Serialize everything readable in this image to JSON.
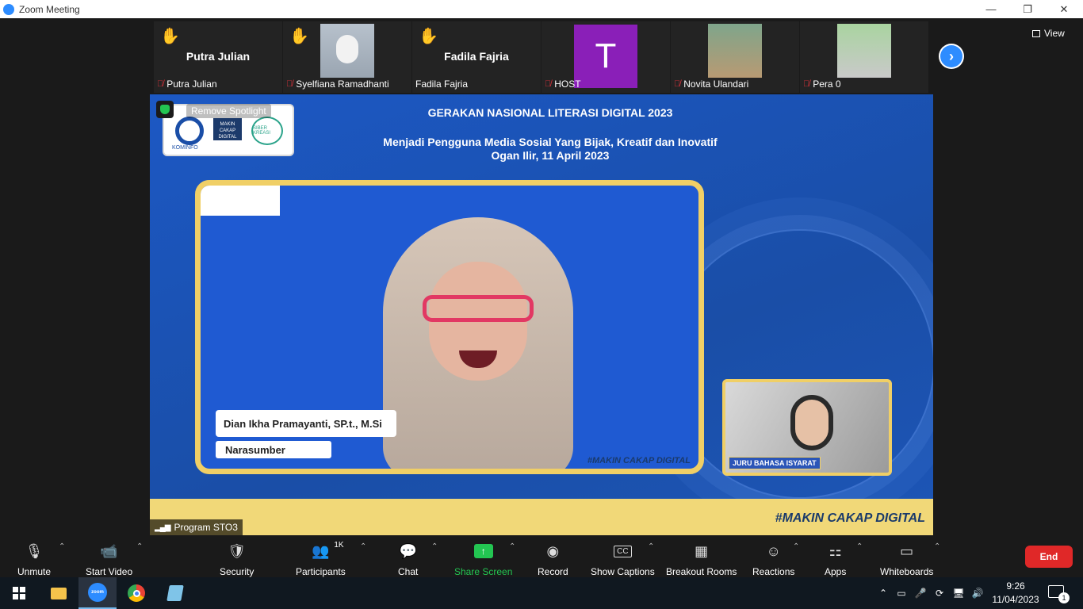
{
  "window": {
    "title": "Zoom Meeting",
    "minimize": "—",
    "restore": "❐",
    "close": "✕"
  },
  "participants": [
    {
      "name": "Putra Julian",
      "display_name": "Putra Julian",
      "hand_raised": true,
      "muted": true,
      "kind": "name"
    },
    {
      "name": "Syelfiana Ramadhanti",
      "hand_raised": true,
      "muted": true,
      "kind": "video"
    },
    {
      "name": "Fadila Fajrja",
      "display_name": "Fadila Fajria",
      "hand_raised": true,
      "muted": false,
      "kind": "name",
      "footer": "Fadila Fajria"
    },
    {
      "name": "HOST",
      "avatar_letter": "T",
      "avatar_color": "#8a1fb8",
      "muted": true,
      "kind": "avatar"
    },
    {
      "name": "Novita Ulandari",
      "muted": true,
      "kind": "video"
    },
    {
      "name": "Pera 0",
      "muted": true,
      "kind": "video"
    }
  ],
  "view_button": "View",
  "spotlight": {
    "remove_label": "Remove Spotlight",
    "title": "GERAKAN NASIONAL LITERASI DIGITAL 2023",
    "subtitle_1": "Menjadi Pengguna Media Sosial Yang Bijak, Kreatif dan Inovatif",
    "subtitle_2": "Ogan Ilir, 11 April 2023",
    "brand_kominfo": "KOMINFO",
    "brand_makin": "MAKIN CAKAP DIGITAL",
    "brand_siberkreasi": "SIBER KREASI",
    "speaker_name": "Dian Ikha Pramayanti, SP.t., M.Si",
    "speaker_role": "Narasumber",
    "frame_tag": "#MAKIN CAKAP DIGITAL",
    "band_tag": "#MAKIN CAKAP DIGITAL",
    "interpreter_label": "JURU BAHASA ISYARAT"
  },
  "program_tag": "Program STO3",
  "toolbar": {
    "unmute": "Unmute",
    "start_video": "Start Video",
    "security": "Security",
    "participants": "Participants",
    "participants_count": "1K",
    "chat": "Chat",
    "share_screen": "Share Screen",
    "record": "Record",
    "show_captions": "Show Captions",
    "breakout_rooms": "Breakout Rooms",
    "reactions": "Reactions",
    "apps": "Apps",
    "whiteboards": "Whiteboards",
    "end": "End",
    "captions_icon": "CC"
  },
  "taskbar": {
    "time": "9:26",
    "date": "11/04/2023",
    "notification_count": "1",
    "zoom_icon_text": "zoom"
  },
  "colors": {
    "accent": "#2d8cff",
    "share_green": "#23c552",
    "end_red": "#e02828",
    "hand_yellow": "#f5b82e"
  }
}
